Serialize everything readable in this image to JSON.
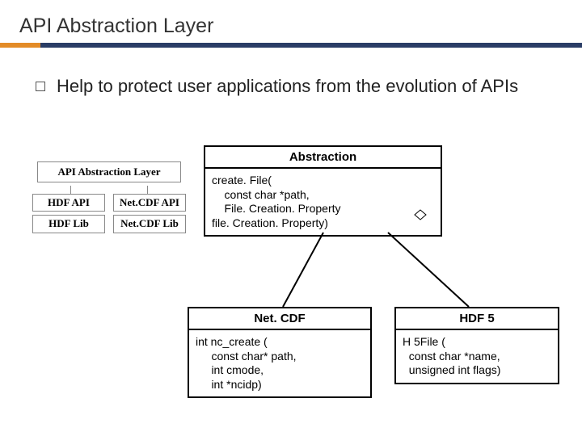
{
  "title": "API Abstraction Layer",
  "bullet": "Help to protect user applications from the evolution of APIs",
  "mini": {
    "top": "API Abstraction Layer",
    "r1a": "HDF\nAPI",
    "r1b": "Net.CDF\nAPI",
    "r2a": "HDF\nLib",
    "r2b": "Net.CDF\nLib"
  },
  "abstraction": {
    "title": "Abstraction",
    "body": "create. File(\n    const char *path,\n    File. Creation. Property\nfile. Creation. Property)"
  },
  "netcdf": {
    "title": "Net. CDF",
    "body": "int nc_create (\n     const char* path,\n     int cmode,\n     int *ncidp)"
  },
  "hdf5": {
    "title": "HDF 5",
    "body": "H 5File (\n  const char *name,\n  unsigned int flags)"
  }
}
